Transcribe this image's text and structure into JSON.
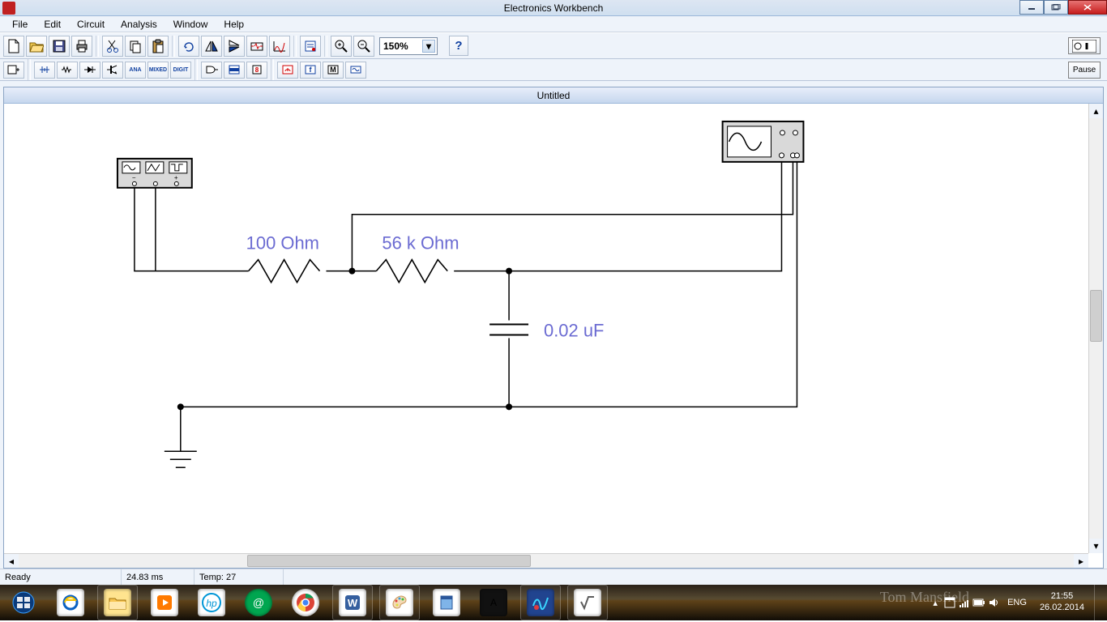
{
  "app": {
    "title": "Electronics Workbench"
  },
  "menu": {
    "items": [
      "File",
      "Edit",
      "Circuit",
      "Analysis",
      "Window",
      "Help"
    ]
  },
  "toolbar": {
    "zoom": "150%",
    "help_label": "?",
    "pause_label": "Pause"
  },
  "document": {
    "title": "Untitled"
  },
  "components": {
    "r1_label": "100  Ohm",
    "r2_label": "56 k Ohm",
    "c1_label": "0.02 uF"
  },
  "status": {
    "ready": "Ready",
    "time": "24.83 ms",
    "temp": "Temp:  27"
  },
  "tray": {
    "lang": "ENG",
    "time": "21:55",
    "date": "26.02.2014"
  },
  "watermark": "Tom Mansfield"
}
